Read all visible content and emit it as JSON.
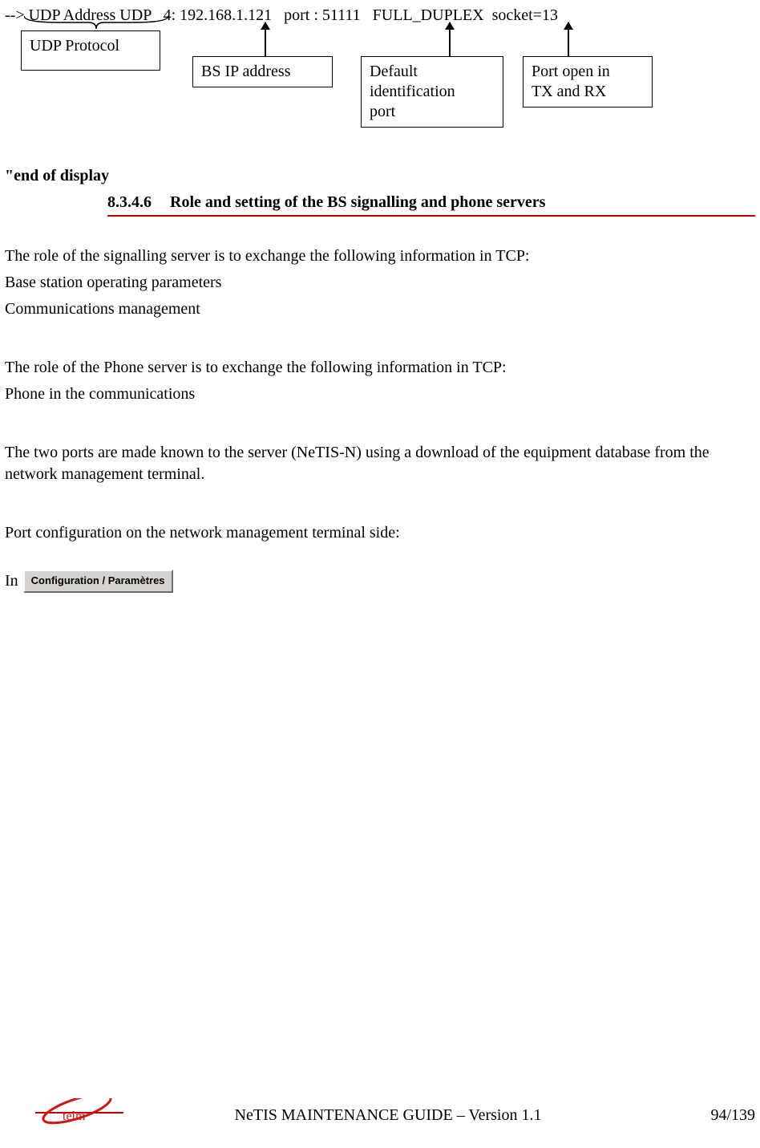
{
  "top_line": "--> UDP Address UDP   4: 192.168.1.121   port : 51111   FULL_DUPLEX  socket=13",
  "boxes": {
    "udp_protocol": "UDP Protocol",
    "bs_ip": "BS IP address",
    "default_id_port": "Default\nidentification\nport",
    "port_open": "Port open in\nTX and RX"
  },
  "end_of_display": "\"end of display",
  "heading": {
    "number": "8.3.4.6",
    "title": "Role and setting of the BS signalling and phone servers"
  },
  "p1": "The role of the signalling server is to exchange the following information in TCP:",
  "p1a": "Base station operating parameters",
  "p1b": "Communications management",
  "p2": "The role of the Phone server is to exchange the following information in TCP:",
  "p2a": "Phone in the communications",
  "p3": "The two ports are made known to the server (NeTIS-N) using a download of the equipment database from the network management terminal.",
  "p4": "Port configuration on the network management terminal side:",
  "in_label": "In",
  "button_label": "Configuration / Paramètres",
  "footer": {
    "logo_text": "telm",
    "center": "NeTIS MAINTENANCE GUIDE – Version 1.1",
    "page": "94/139"
  }
}
